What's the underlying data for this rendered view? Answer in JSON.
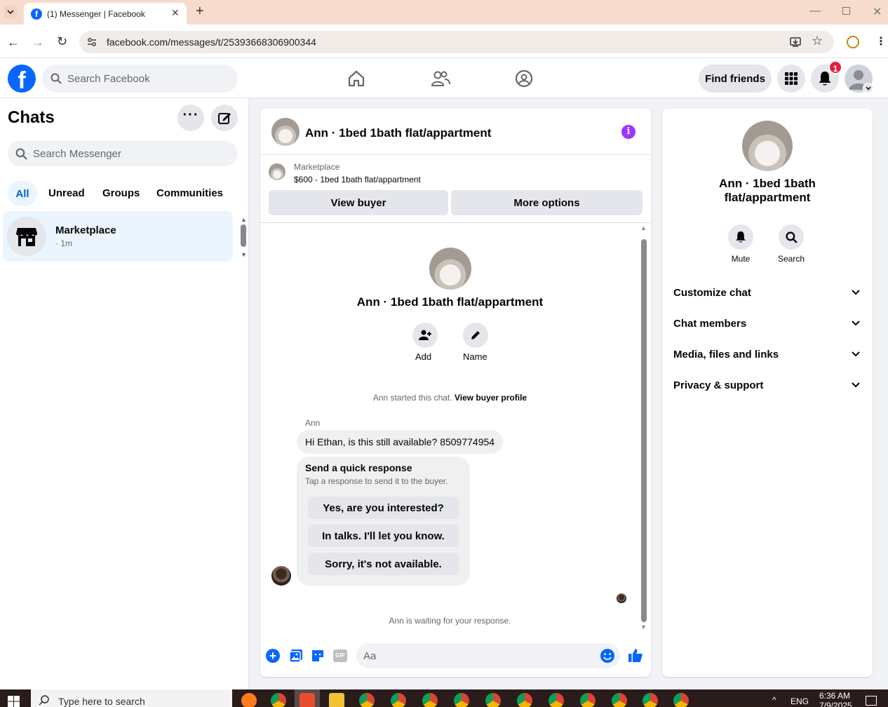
{
  "browser": {
    "tab_title": "(1) Messenger | Facebook",
    "url": "facebook.com/messages/t/25393668306900344"
  },
  "fb": {
    "search_placeholder": "Search Facebook",
    "find_friends": "Find friends",
    "notification_count": "1",
    "brand_color": "#0866ff"
  },
  "sidebar": {
    "title": "Chats",
    "search_placeholder": "Search Messenger",
    "filters": [
      "All",
      "Unread",
      "Groups",
      "Communities"
    ],
    "chat": {
      "name": "Marketplace",
      "time": "· 1m"
    }
  },
  "conversation": {
    "title": "Ann · 1bed 1bath flat/appartment",
    "listing_label": "Marketplace",
    "listing_price_title": "$600 - 1bed 1bath flat/appartment",
    "view_buyer": "View buyer",
    "more_options": "More options",
    "profile_name": "Ann · 1bed 1bath flat/appartment",
    "add_label": "Add",
    "name_label": "Name",
    "started_text": "Ann started this chat.",
    "view_buyer_profile": "View buyer profile",
    "sender": "Ann",
    "message": "Hi Ethan, is this still available? 8509774954",
    "quick_title": "Send a quick response",
    "quick_sub": "Tap a response to send it to the buyer.",
    "quick_responses": [
      "Yes, are you interested?",
      "In talks. I'll let you know.",
      "Sorry, it's not available."
    ],
    "waiting_text": "Ann is waiting for your response.",
    "composer_placeholder": "Aa",
    "gif_label": "GIF"
  },
  "details": {
    "name": "Ann · 1bed 1bath flat/appartment",
    "mute": "Mute",
    "search": "Search",
    "sections": [
      "Customize chat",
      "Chat members",
      "Media, files and links",
      "Privacy & support"
    ]
  },
  "taskbar": {
    "search_placeholder": "Type here to search",
    "lang": "ENG",
    "time": "6:36 AM",
    "date": "7/9/2025"
  }
}
